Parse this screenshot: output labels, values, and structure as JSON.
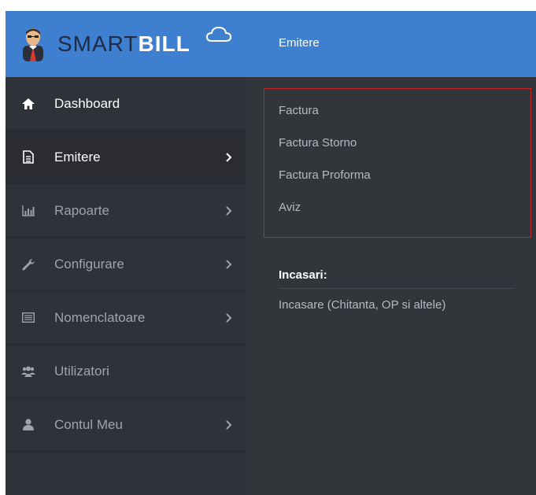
{
  "logo": {
    "part1": "SMART",
    "part2": "BILL"
  },
  "header": {
    "title": "Emitere"
  },
  "sidebar": {
    "items": [
      {
        "label": "Dashboard",
        "icon": "home-icon"
      },
      {
        "label": "Emitere",
        "icon": "document-icon"
      },
      {
        "label": "Rapoarte",
        "icon": "bar-chart-icon"
      },
      {
        "label": "Configurare",
        "icon": "wrench-icon"
      },
      {
        "label": "Nomenclatoare",
        "icon": "list-icon"
      },
      {
        "label": "Utilizatori",
        "icon": "users-icon"
      },
      {
        "label": "Contul Meu",
        "icon": "user-icon"
      }
    ]
  },
  "submenu": {
    "items": [
      "Factura",
      "Factura Storno",
      "Factura Proforma",
      "Aviz"
    ]
  },
  "incasari": {
    "title": "Incasari:",
    "item": "Incasare (Chitanta, OP si altele)"
  },
  "colors": {
    "header_blue": "#3f7fd0",
    "sidebar_bg": "#2f3238",
    "main_bg": "#32353a",
    "highlight_border": "#c6232a"
  }
}
